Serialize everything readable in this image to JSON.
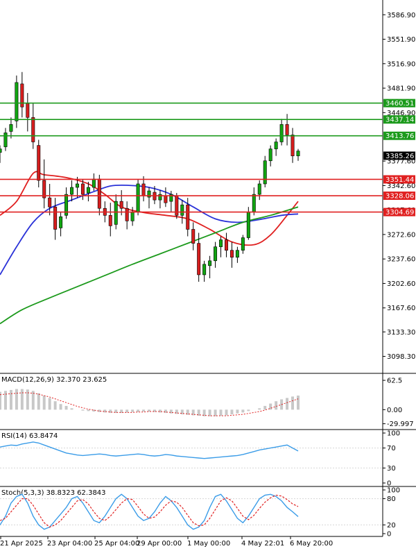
{
  "colors": {
    "background": "#ffffff",
    "axis": "#000000",
    "grid": "#d6d6d6",
    "bull_candle": "#11a411",
    "bear_candle": "#d61e1e",
    "candle_wick": "#000000",
    "ma_red": "#e02020",
    "ma_blue": "#2a32d8",
    "ma_green": "#1c9a1c",
    "resistance_line": "#1c9a1c",
    "support_line": "#e02020",
    "current_price_label": "#000000",
    "macd_hist": "#c8c8c8",
    "macd_signal": "#e02020",
    "rsi_line": "#3a9ce8",
    "stoch_main": "#3a9ce8",
    "stoch_signal": "#e02020"
  },
  "chart_data": {
    "type": "candlestick",
    "price_axis": {
      "ticks": [
        "3586.90",
        "3551.90",
        "3516.90",
        "3481.90",
        "3446.90",
        "3377.60",
        "3342.60",
        "3307.60",
        "3272.60",
        "3237.60",
        "3202.60",
        "3167.60",
        "3133.30",
        "3098.30"
      ],
      "range": [
        3075,
        3608
      ]
    },
    "x_axis": {
      "labels": [
        "21 Apr 2025",
        "23 Apr 04:00",
        "25 Apr 04:00",
        "29 Apr 00:00",
        "1 May 00:00",
        "4 May 22:01",
        "6 May 20:00"
      ]
    },
    "levels": [
      {
        "value": 3460.51,
        "label": "3460.51",
        "kind": "resistance"
      },
      {
        "value": 3437.14,
        "label": "3437.14",
        "kind": "resistance"
      },
      {
        "value": 3413.76,
        "label": "3413.76",
        "kind": "resistance"
      },
      {
        "value": 3351.44,
        "label": "3351.44",
        "kind": "support"
      },
      {
        "value": 3328.06,
        "label": "3328.06",
        "kind": "support"
      },
      {
        "value": 3304.69,
        "label": "3304.69",
        "kind": "support"
      }
    ],
    "current_price": {
      "value": 3385.26,
      "label": "3385.26"
    },
    "candles": [
      [
        3390,
        3400,
        3375,
        3395
      ],
      [
        3398,
        3425,
        3392,
        3418
      ],
      [
        3420,
        3440,
        3410,
        3430
      ],
      [
        3435,
        3500,
        3425,
        3490
      ],
      [
        3488,
        3505,
        3440,
        3455
      ],
      [
        3460,
        3475,
        3420,
        3440
      ],
      [
        3440,
        3460,
        3395,
        3405
      ],
      [
        3400,
        3408,
        3340,
        3350
      ],
      [
        3350,
        3380,
        3310,
        3325
      ],
      [
        3325,
        3345,
        3300,
        3312
      ],
      [
        3312,
        3325,
        3265,
        3280
      ],
      [
        3282,
        3305,
        3270,
        3298
      ],
      [
        3300,
        3340,
        3295,
        3330
      ],
      [
        3330,
        3350,
        3320,
        3340
      ],
      [
        3340,
        3355,
        3325,
        3345
      ],
      [
        3345,
        3352,
        3322,
        3330
      ],
      [
        3332,
        3348,
        3320,
        3340
      ],
      [
        3340,
        3360,
        3335,
        3352
      ],
      [
        3352,
        3358,
        3300,
        3310
      ],
      [
        3310,
        3320,
        3290,
        3300
      ],
      [
        3300,
        3318,
        3270,
        3285
      ],
      [
        3287,
        3330,
        3280,
        3320
      ],
      [
        3320,
        3336,
        3300,
        3310
      ],
      [
        3310,
        3320,
        3280,
        3292
      ],
      [
        3292,
        3312,
        3285,
        3305
      ],
      [
        3305,
        3352,
        3300,
        3345
      ],
      [
        3345,
        3356,
        3320,
        3328
      ],
      [
        3326,
        3340,
        3310,
        3335
      ],
      [
        3333,
        3342,
        3316,
        3322
      ],
      [
        3322,
        3336,
        3310,
        3330
      ],
      [
        3328,
        3340,
        3312,
        3318
      ],
      [
        3320,
        3335,
        3305,
        3330
      ],
      [
        3328,
        3332,
        3295,
        3300
      ],
      [
        3300,
        3322,
        3288,
        3315
      ],
      [
        3315,
        3325,
        3270,
        3280
      ],
      [
        3280,
        3290,
        3250,
        3260
      ],
      [
        3260,
        3275,
        3205,
        3215
      ],
      [
        3215,
        3235,
        3205,
        3230
      ],
      [
        3228,
        3242,
        3210,
        3235
      ],
      [
        3235,
        3262,
        3225,
        3255
      ],
      [
        3255,
        3270,
        3240,
        3265
      ],
      [
        3265,
        3275,
        3240,
        3250
      ],
      [
        3250,
        3262,
        3225,
        3240
      ],
      [
        3240,
        3255,
        3232,
        3250
      ],
      [
        3250,
        3272,
        3245,
        3268
      ],
      [
        3268,
        3312,
        3265,
        3305
      ],
      [
        3305,
        3340,
        3300,
        3330
      ],
      [
        3330,
        3350,
        3322,
        3345
      ],
      [
        3345,
        3385,
        3340,
        3378
      ],
      [
        3378,
        3400,
        3370,
        3395
      ],
      [
        3395,
        3410,
        3385,
        3405
      ],
      [
        3405,
        3438,
        3400,
        3430
      ],
      [
        3430,
        3445,
        3400,
        3415
      ],
      [
        3415,
        3425,
        3375,
        3385
      ],
      [
        3385,
        3395,
        3378,
        3392
      ]
    ],
    "moving_averages": [
      {
        "color_key": "ma_red",
        "values": [
          [
            0,
            3300
          ],
          [
            3,
            3320
          ],
          [
            6,
            3360
          ],
          [
            8,
            3358
          ],
          [
            12,
            3354
          ],
          [
            16,
            3345
          ],
          [
            19,
            3330
          ],
          [
            22,
            3312
          ],
          [
            26,
            3304
          ],
          [
            30,
            3300
          ],
          [
            34,
            3295
          ],
          [
            38,
            3280
          ],
          [
            42,
            3262
          ],
          [
            46,
            3258
          ],
          [
            49,
            3272
          ],
          [
            52,
            3300
          ],
          [
            54,
            3320
          ]
        ]
      },
      {
        "color_key": "ma_blue",
        "values": [
          [
            0,
            3215
          ],
          [
            3,
            3255
          ],
          [
            6,
            3290
          ],
          [
            9,
            3310
          ],
          [
            13,
            3322
          ],
          [
            17,
            3334
          ],
          [
            20,
            3342
          ],
          [
            23,
            3343
          ],
          [
            27,
            3340
          ],
          [
            31,
            3330
          ],
          [
            35,
            3312
          ],
          [
            39,
            3295
          ],
          [
            43,
            3290
          ],
          [
            47,
            3294
          ],
          [
            51,
            3300
          ],
          [
            54,
            3302
          ]
        ]
      },
      {
        "color_key": "ma_green",
        "values": [
          [
            0,
            3145
          ],
          [
            4,
            3165
          ],
          [
            9,
            3182
          ],
          [
            14,
            3198
          ],
          [
            19,
            3214
          ],
          [
            24,
            3230
          ],
          [
            29,
            3245
          ],
          [
            34,
            3260
          ],
          [
            39,
            3275
          ],
          [
            44,
            3290
          ],
          [
            49,
            3300
          ],
          [
            54,
            3312
          ]
        ]
      }
    ],
    "indicators": [
      {
        "name": "MACD(12,26,9)",
        "label": "MACD(12,26,9) 32.370 23.625",
        "ticks": [
          "62.5",
          "0.00",
          "-29.997"
        ],
        "range": [
          -35,
          70
        ],
        "histogram": [
          38,
          40,
          42,
          44,
          44,
          43,
          40,
          35,
          30,
          25,
          18,
          12,
          8,
          3,
          0,
          -2,
          -3,
          -4,
          -5,
          -6,
          -7,
          -7,
          -7,
          -6,
          -5,
          -5,
          -4,
          -4,
          -5,
          -6,
          -7,
          -8,
          -9,
          -10,
          -11,
          -12,
          -13,
          -14,
          -14,
          -14,
          -13,
          -12,
          -10,
          -8,
          -6,
          -3,
          0,
          3,
          8,
          13,
          18,
          22,
          25,
          28,
          30
        ],
        "signal": [
          32,
          33,
          34,
          35,
          36,
          36,
          35,
          33,
          30,
          27,
          23,
          19,
          15,
          11,
          7,
          4,
          1,
          -1,
          -3,
          -4,
          -5,
          -6,
          -6,
          -6,
          -6,
          -5,
          -5,
          -4,
          -4,
          -4,
          -5,
          -6,
          -7,
          -8,
          -9,
          -10,
          -11,
          -12,
          -13,
          -13,
          -13,
          -13,
          -12,
          -11,
          -10,
          -8,
          -6,
          -4,
          -1,
          3,
          7,
          11,
          15,
          19,
          23
        ]
      },
      {
        "name": "RSI(14)",
        "label": "RSI(14) 63.8474",
        "ticks": [
          "100",
          "70",
          "30",
          "0"
        ],
        "range": [
          0,
          100
        ],
        "values": [
          72,
          74,
          76,
          75,
          78,
          80,
          82,
          80,
          76,
          72,
          68,
          64,
          60,
          58,
          56,
          55,
          56,
          57,
          58,
          57,
          55,
          54,
          55,
          56,
          57,
          58,
          57,
          55,
          54,
          55,
          57,
          56,
          54,
          53,
          52,
          51,
          50,
          49,
          50,
          51,
          52,
          53,
          54,
          55,
          57,
          60,
          63,
          66,
          68,
          70,
          72,
          74,
          76,
          70,
          64
        ]
      },
      {
        "name": "Stoch(5,3,3)",
        "label": "Stoch(5,3,3) 38.8323 62.3843",
        "ticks": [
          "100",
          "80",
          "20",
          "0"
        ],
        "range": [
          0,
          100
        ],
        "main": [
          20,
          40,
          70,
          85,
          90,
          70,
          40,
          20,
          10,
          15,
          30,
          45,
          60,
          80,
          85,
          70,
          50,
          30,
          25,
          40,
          60,
          80,
          90,
          80,
          60,
          40,
          30,
          35,
          50,
          70,
          85,
          75,
          60,
          40,
          20,
          10,
          15,
          30,
          60,
          85,
          90,
          75,
          55,
          35,
          25,
          40,
          60,
          80,
          88,
          90,
          85,
          75,
          60,
          50,
          39
        ],
        "signal": [
          30,
          35,
          50,
          65,
          80,
          80,
          65,
          45,
          25,
          15,
          20,
          30,
          45,
          60,
          75,
          78,
          68,
          50,
          35,
          30,
          40,
          55,
          70,
          80,
          78,
          62,
          45,
          35,
          38,
          50,
          65,
          75,
          72,
          60,
          42,
          25,
          18,
          20,
          35,
          55,
          75,
          82,
          75,
          58,
          40,
          32,
          42,
          58,
          72,
          82,
          88,
          86,
          78,
          68,
          62
        ]
      }
    ]
  }
}
